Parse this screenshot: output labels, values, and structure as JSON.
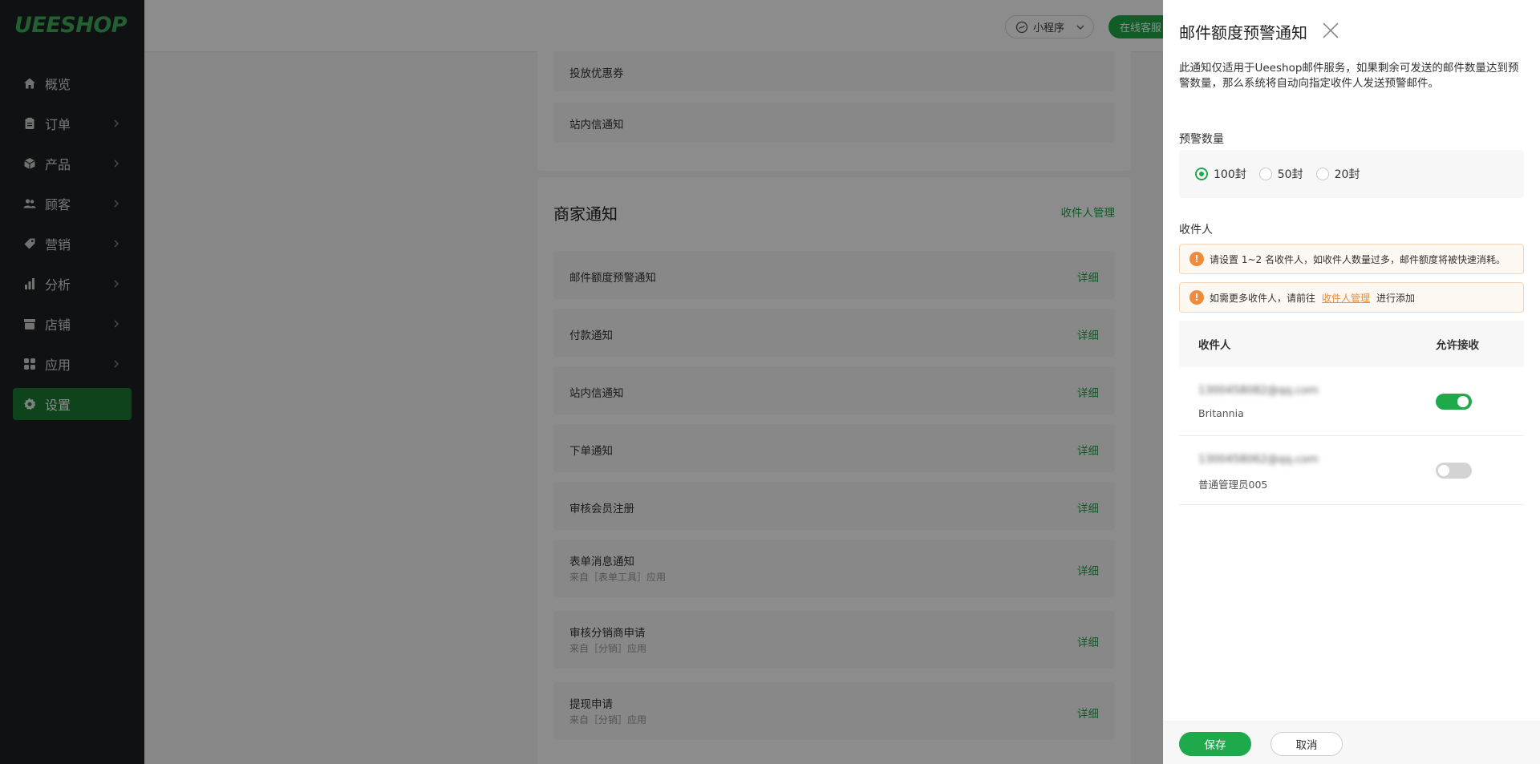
{
  "sidebar": {
    "logo": "UEESHOP",
    "items": [
      {
        "label": "概览",
        "icon": "home-icon"
      },
      {
        "label": "订单",
        "icon": "clipboard-icon"
      },
      {
        "label": "产品",
        "icon": "box-icon"
      },
      {
        "label": "顾客",
        "icon": "users-icon"
      },
      {
        "label": "营销",
        "icon": "tag-icon"
      },
      {
        "label": "分析",
        "icon": "bar-chart-icon"
      },
      {
        "label": "店铺",
        "icon": "store-icon"
      },
      {
        "label": "应用",
        "icon": "apps-icon"
      },
      {
        "label": "设置",
        "icon": "gear-icon"
      }
    ]
  },
  "topbar": {
    "mini_program": "小程序",
    "online_service": "在线客服"
  },
  "card1": {
    "rows": [
      {
        "title": "投放优惠券"
      },
      {
        "title": "站内信通知"
      }
    ]
  },
  "card2": {
    "title": "商家通知",
    "manage_link": "收件人管理",
    "detail_label": "详细",
    "rows": [
      {
        "title": "邮件额度预警通知",
        "sub": ""
      },
      {
        "title": "付款通知",
        "sub": ""
      },
      {
        "title": "站内信通知",
        "sub": ""
      },
      {
        "title": "下单通知",
        "sub": ""
      },
      {
        "title": "审核会员注册",
        "sub": ""
      },
      {
        "title": "表单消息通知",
        "sub": "来自［表单工具］应用"
      },
      {
        "title": "审核分销商申请",
        "sub": "来自［分销］应用"
      },
      {
        "title": "提现申请",
        "sub": "来自［分销］应用"
      }
    ]
  },
  "drawer": {
    "title": "邮件额度预警通知",
    "description": "此通知仅适用于Ueeshop邮件服务，如果剩余可发送的邮件数量达到预警数量，那么系统将自动向指定收件人发送预警邮件。",
    "threshold_label": "预警数量",
    "options": [
      {
        "label": "100封",
        "checked": true
      },
      {
        "label": "50封",
        "checked": false
      },
      {
        "label": "20封",
        "checked": false
      }
    ],
    "recipients_label": "收件人",
    "alert1": "请设置 1~2 名收件人，如收件人数量过多，邮件额度将被快速消耗。",
    "alert2_prefix": "如需更多收件人，请前往",
    "alert2_link": "收件人管理",
    "alert2_suffix": "进行添加",
    "table": {
      "col_recipient": "收件人",
      "col_allow": "允许接收",
      "rows": [
        {
          "email": "1300458082@qq.com",
          "name": "Britannia",
          "enabled": true
        },
        {
          "email": "1300458062@qq.com",
          "name": "普通管理员005",
          "enabled": false
        }
      ]
    },
    "save": "保存",
    "cancel": "取消"
  },
  "colors": {
    "accent": "#1eaa4a",
    "sidebar_bg": "#1e1f21",
    "sidebar_active": "#1c7a34",
    "warning": "#f08a3c"
  }
}
